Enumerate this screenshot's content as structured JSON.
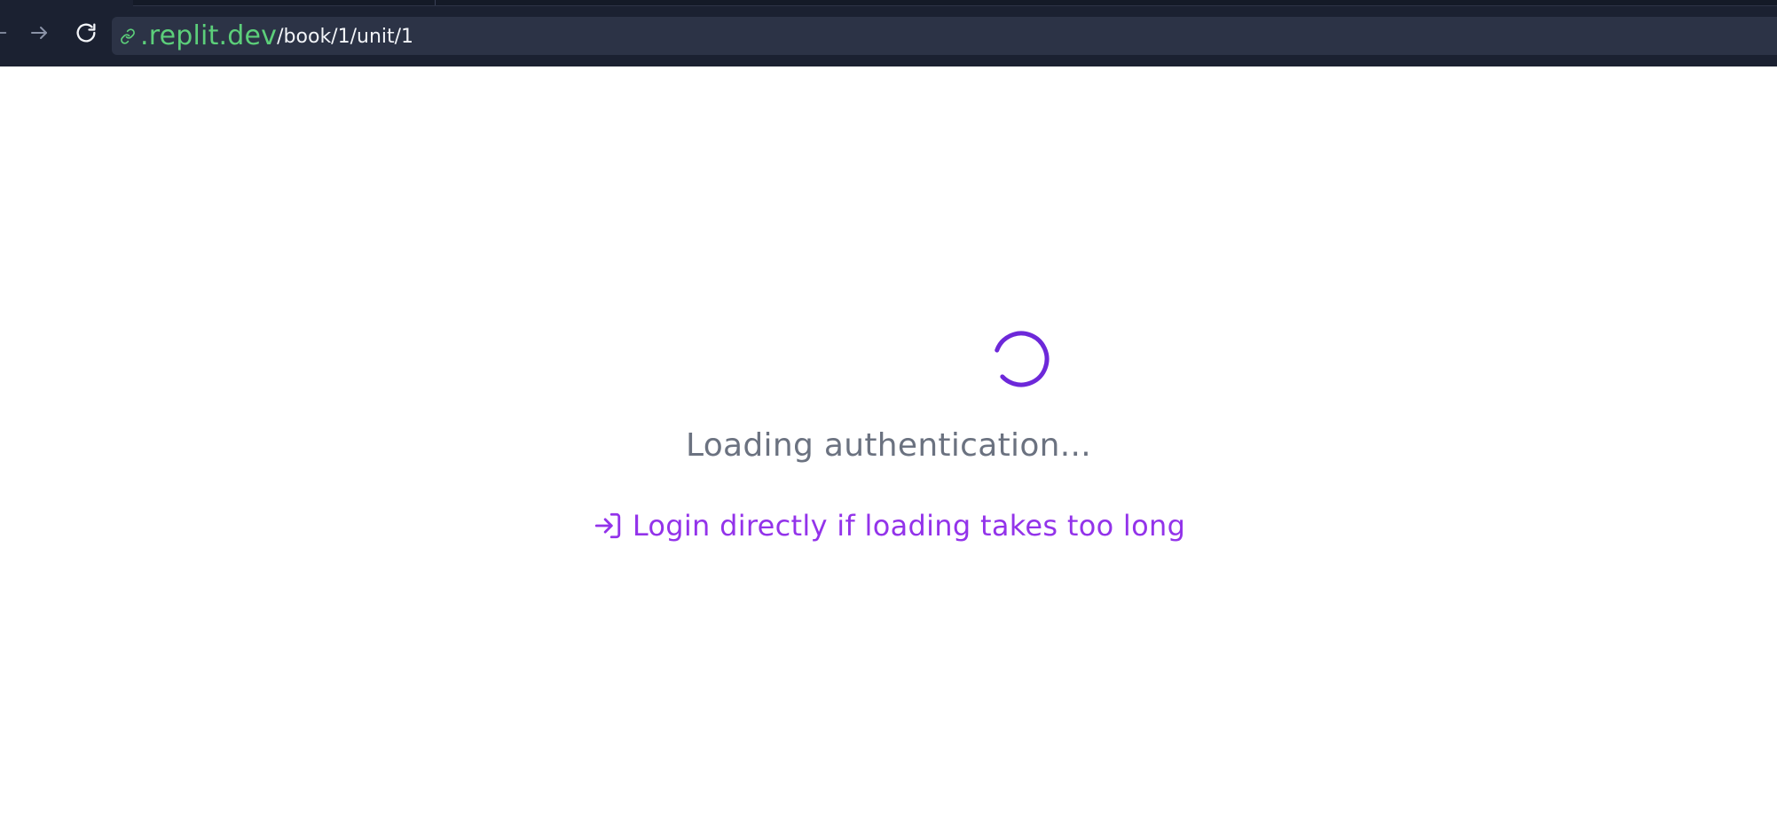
{
  "browser": {
    "address_bar": {
      "domain": ".replit.dev",
      "path": "/book/1/unit/1"
    },
    "icons": {
      "back": "arrow-left-icon",
      "forward": "arrow-right-icon",
      "reload": "reload-icon",
      "link": "link-icon"
    },
    "colors": {
      "toolbar_bg": "#1b2131",
      "urlbar_bg": "#2c3346",
      "domain": "#5ccf7a",
      "path": "#f2f4f8"
    }
  },
  "main": {
    "loading_text": "Loading authentication...",
    "login_link": {
      "label": "Login directly if loading takes too long",
      "icon": "login-icon"
    },
    "colors": {
      "spinner": "#6d28d9",
      "loading_text": "#6b7280",
      "login_link": "#9333ea"
    }
  }
}
